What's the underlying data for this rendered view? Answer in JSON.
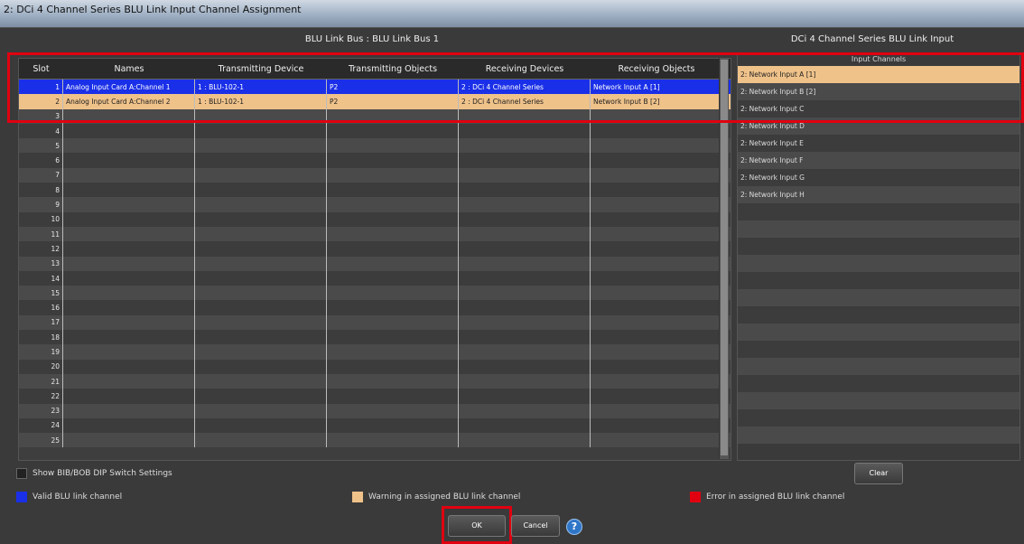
{
  "window": {
    "title": "2: DCi 4 Channel Series BLU Link Input Channel Assignment"
  },
  "headers": {
    "bus": "BLU Link Bus : BLU Link Bus 1",
    "input": "DCi 4 Channel Series BLU Link Input"
  },
  "grid": {
    "columns": [
      "Slot",
      "Names",
      "Transmitting Device",
      "Transmitting Objects",
      "Receiving Devices",
      "Receiving Objects"
    ],
    "rows": [
      {
        "slot": "1",
        "name": "Analog Input Card A:Channel 1",
        "txd": "1 : BLU-102-1",
        "txo": "P2",
        "rxd": "2 : DCi 4 Channel Series",
        "rxo": "Network Input A [1]",
        "status": "valid"
      },
      {
        "slot": "2",
        "name": "Analog Input Card A:Channel 2",
        "txd": "1 : BLU-102-1",
        "txo": "P2",
        "rxd": "2 : DCi 4 Channel Series",
        "rxo": "Network Input B [2]",
        "status": "warning"
      },
      {
        "slot": "3"
      },
      {
        "slot": "4"
      },
      {
        "slot": "5"
      },
      {
        "slot": "6"
      },
      {
        "slot": "7"
      },
      {
        "slot": "8"
      },
      {
        "slot": "9"
      },
      {
        "slot": "10"
      },
      {
        "slot": "11"
      },
      {
        "slot": "12"
      },
      {
        "slot": "13"
      },
      {
        "slot": "14"
      },
      {
        "slot": "15"
      },
      {
        "slot": "16"
      },
      {
        "slot": "17"
      },
      {
        "slot": "18"
      },
      {
        "slot": "19"
      },
      {
        "slot": "20"
      },
      {
        "slot": "21"
      },
      {
        "slot": "22"
      },
      {
        "slot": "23"
      },
      {
        "slot": "24"
      },
      {
        "slot": "25"
      }
    ]
  },
  "input_channels": {
    "title": "Input Channels",
    "items": [
      {
        "label": "2: Network Input A [1]",
        "selected": true
      },
      {
        "label": "2: Network Input B [2]"
      },
      {
        "label": "2: Network Input C"
      },
      {
        "label": "2: Network Input D"
      },
      {
        "label": "2: Network Input E"
      },
      {
        "label": "2: Network Input F"
      },
      {
        "label": "2: Network Input G"
      },
      {
        "label": "2: Network Input H"
      }
    ]
  },
  "controls": {
    "show_dip": "Show BIB/BOB DIP Switch Settings",
    "clear": "Clear",
    "ok": "OK",
    "cancel": "Cancel",
    "help_glyph": "?"
  },
  "legend": [
    {
      "label": "Valid BLU link channel",
      "color": "#1a2fe8"
    },
    {
      "label": "Warning in assigned BLU link channel",
      "color": "#efc28a"
    },
    {
      "label": "Error in assigned BLU link channel",
      "color": "#e00010"
    }
  ]
}
